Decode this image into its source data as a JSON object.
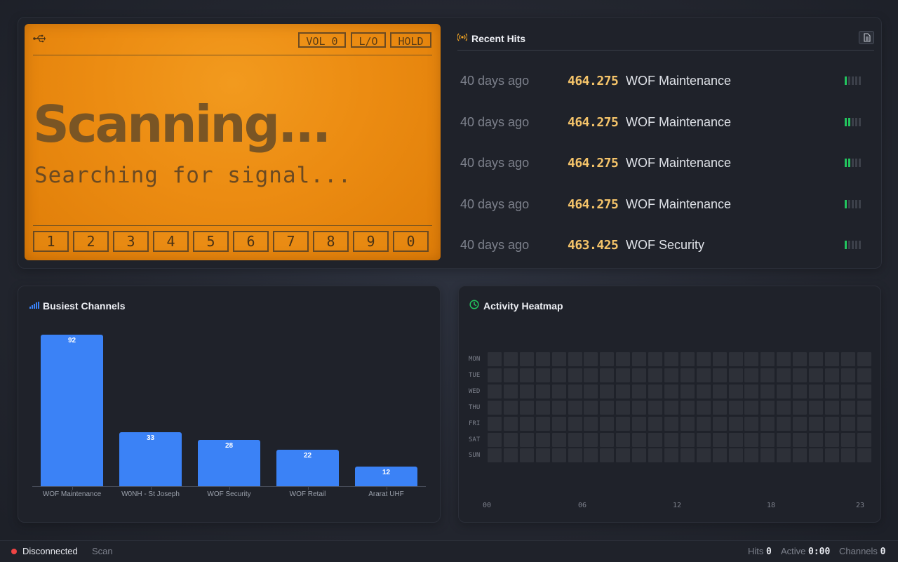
{
  "lcd": {
    "indicators": [
      "VOL 0",
      "L/O",
      "HOLD"
    ],
    "status": "Scanning...",
    "message": "Searching for signal...",
    "keypad": [
      "1",
      "2",
      "3",
      "4",
      "5",
      "6",
      "7",
      "8",
      "9",
      "0"
    ]
  },
  "recent_hits": {
    "title": "Recent Hits",
    "rows": [
      {
        "ago": "40 days ago",
        "freq": "464.275",
        "name": "WOF Maintenance",
        "signal": 1
      },
      {
        "ago": "40 days ago",
        "freq": "464.275",
        "name": "WOF Maintenance",
        "signal": 2
      },
      {
        "ago": "40 days ago",
        "freq": "464.275",
        "name": "WOF Maintenance",
        "signal": 2
      },
      {
        "ago": "40 days ago",
        "freq": "464.275",
        "name": "WOF Maintenance",
        "signal": 1
      },
      {
        "ago": "40 days ago",
        "freq": "463.425",
        "name": "WOF Security",
        "signal": 1
      }
    ]
  },
  "busiest": {
    "title": "Busiest Channels"
  },
  "heatmap": {
    "title": "Activity Heatmap",
    "days": [
      "MON",
      "TUE",
      "WED",
      "THU",
      "FRI",
      "SAT",
      "SUN"
    ],
    "hour_labels": [
      "00",
      "06",
      "12",
      "18",
      "23"
    ]
  },
  "status_bar": {
    "connection": "Disconnected",
    "mode": "Scan",
    "hits_label": "Hits",
    "hits_value": "0",
    "active_label": "Active",
    "active_value": "0:00",
    "channels_label": "Channels",
    "channels_value": "0"
  },
  "colors": {
    "lcd": "#ec8c12",
    "bar": "#3b82f6",
    "signal_on": "#22c55e",
    "freq": "#f5c46a",
    "disconnected": "#ef4444"
  },
  "chart_data": {
    "type": "bar",
    "title": "Busiest Channels",
    "categories": [
      "WOF Maintenance",
      "W0NH - St Joseph",
      "WOF Security",
      "WOF Retail",
      "Ararat UHF"
    ],
    "values": [
      92,
      33,
      28,
      22,
      12
    ],
    "xlabel": "",
    "ylabel": "",
    "ylim": [
      0,
      92
    ],
    "grid": false
  }
}
